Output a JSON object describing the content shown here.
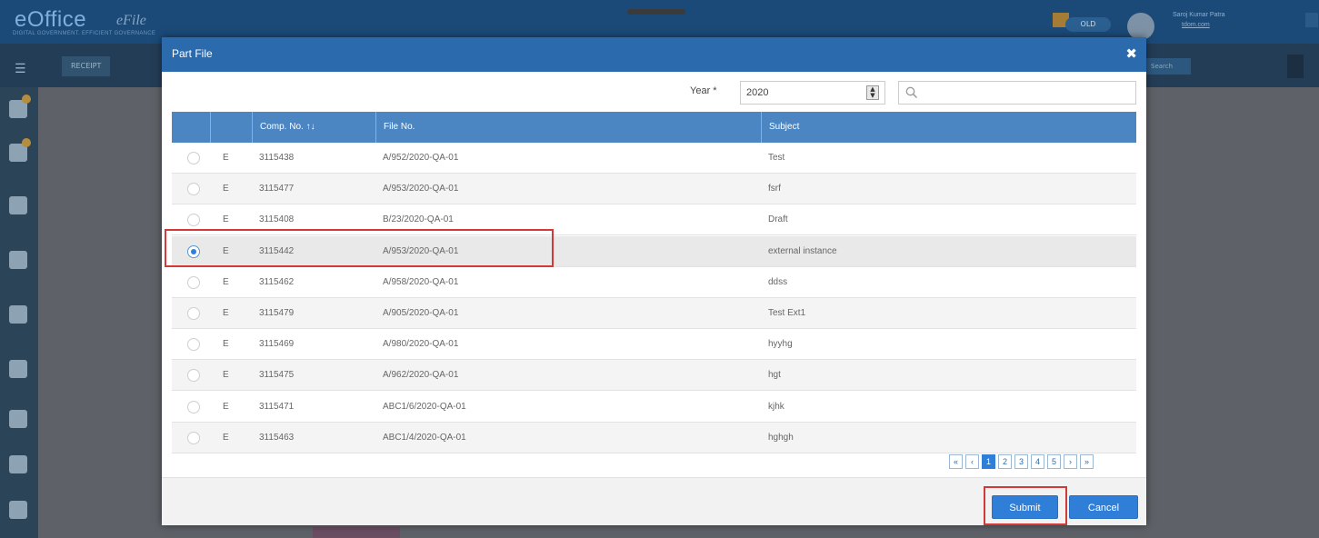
{
  "app": {
    "logo": "eOffice",
    "logo_tagline": "DIGITAL GOVERNMENT. EFFICIENT GOVERNANCE",
    "module": "eFile",
    "toggle_label": "OLD",
    "user_name": "Saroj Kumar Patra",
    "user_role": "tdom.com"
  },
  "toolbar": {
    "receipt_label": "RECEIPT",
    "search_label": "Search"
  },
  "modal": {
    "title": "Part File",
    "close_glyph": "✖",
    "year_label": "Year *",
    "year_value": "2020",
    "search_placeholder": "",
    "columns": {
      "type": "",
      "comp_no": "Comp. No. ↑↓",
      "file_no": "File No.",
      "subject": "Subject"
    },
    "rows": [
      {
        "type": "E",
        "comp_no": "3115438",
        "file_no": "A/952/2020-QA-01",
        "subject": "Test",
        "selected": false
      },
      {
        "type": "E",
        "comp_no": "3115477",
        "file_no": "A/953/2020-QA-01",
        "subject": "fsrf",
        "selected": false
      },
      {
        "type": "E",
        "comp_no": "3115408",
        "file_no": "B/23/2020-QA-01",
        "subject": "Draft",
        "selected": false
      },
      {
        "type": "E",
        "comp_no": "3115442",
        "file_no": "A/953/2020-QA-01",
        "subject": "external instance",
        "selected": true
      },
      {
        "type": "E",
        "comp_no": "3115462",
        "file_no": "A/958/2020-QA-01",
        "subject": "ddss",
        "selected": false
      },
      {
        "type": "E",
        "comp_no": "3115479",
        "file_no": "A/905/2020-QA-01",
        "subject": "Test Ext1",
        "selected": false
      },
      {
        "type": "E",
        "comp_no": "3115469",
        "file_no": "A/980/2020-QA-01",
        "subject": "hyyhg",
        "selected": false
      },
      {
        "type": "E",
        "comp_no": "3115475",
        "file_no": "A/962/2020-QA-01",
        "subject": "hgt",
        "selected": false
      },
      {
        "type": "E",
        "comp_no": "3115471",
        "file_no": "ABC1/6/2020-QA-01",
        "subject": "kjhk",
        "selected": false
      },
      {
        "type": "E",
        "comp_no": "3115463",
        "file_no": "ABC1/4/2020-QA-01",
        "subject": "hghgh",
        "selected": false
      }
    ],
    "pagination": {
      "first": "«",
      "prev": "‹",
      "pages": [
        "1",
        "2",
        "3",
        "4",
        "5"
      ],
      "current_page": 1,
      "next": "›",
      "last": "»"
    },
    "buttons": {
      "submit": "Submit",
      "cancel": "Cancel"
    }
  },
  "icons": {
    "close": "close-icon",
    "search": "search-icon",
    "spinner": "spinner-icon"
  },
  "colors": {
    "header_blue": "#2b6bad",
    "table_header_blue": "#4b86c2",
    "button_blue": "#2f7ed8",
    "highlight_red": "#d23a3a"
  }
}
